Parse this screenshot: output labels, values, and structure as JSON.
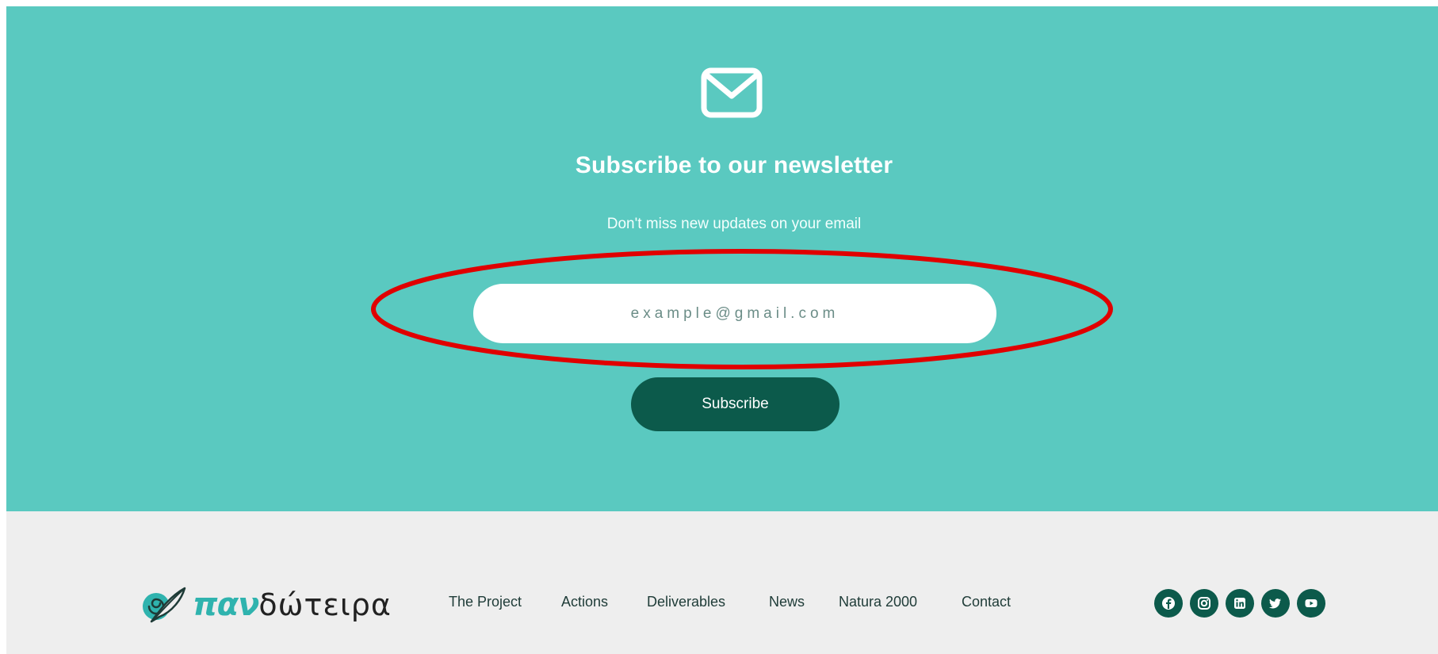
{
  "newsletter": {
    "icon": "envelope-icon",
    "title": "Subscribe to our newsletter",
    "subtitle": "Don't miss new updates on your email",
    "email_placeholder": "example@gmail.com",
    "subscribe_label": "Subscribe",
    "background_color": "#5ac9c0",
    "button_color": "#0c5a4b",
    "highlight_color": "#e00000"
  },
  "footer": {
    "logo": {
      "icon": "leaf-spiral-icon",
      "part1": "παν",
      "part2": "δώτειρα"
    },
    "nav": [
      {
        "label": "The Project"
      },
      {
        "label": "Actions"
      },
      {
        "label": "Deliverables"
      },
      {
        "label": "News"
      },
      {
        "label": "Natura 2000"
      },
      {
        "label": "Contact"
      }
    ],
    "socials": [
      {
        "icon": "facebook-icon"
      },
      {
        "icon": "instagram-icon"
      },
      {
        "icon": "linkedin-icon"
      },
      {
        "icon": "twitter-icon"
      },
      {
        "icon": "youtube-icon"
      }
    ],
    "background_color": "#eeeeee"
  }
}
